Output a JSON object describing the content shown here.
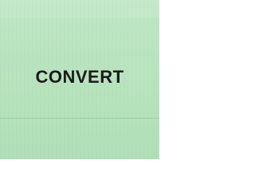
{
  "button": {
    "label": "CONVERT"
  },
  "colors": {
    "background": "#b7e3bd",
    "text": "#1b1b1b"
  }
}
